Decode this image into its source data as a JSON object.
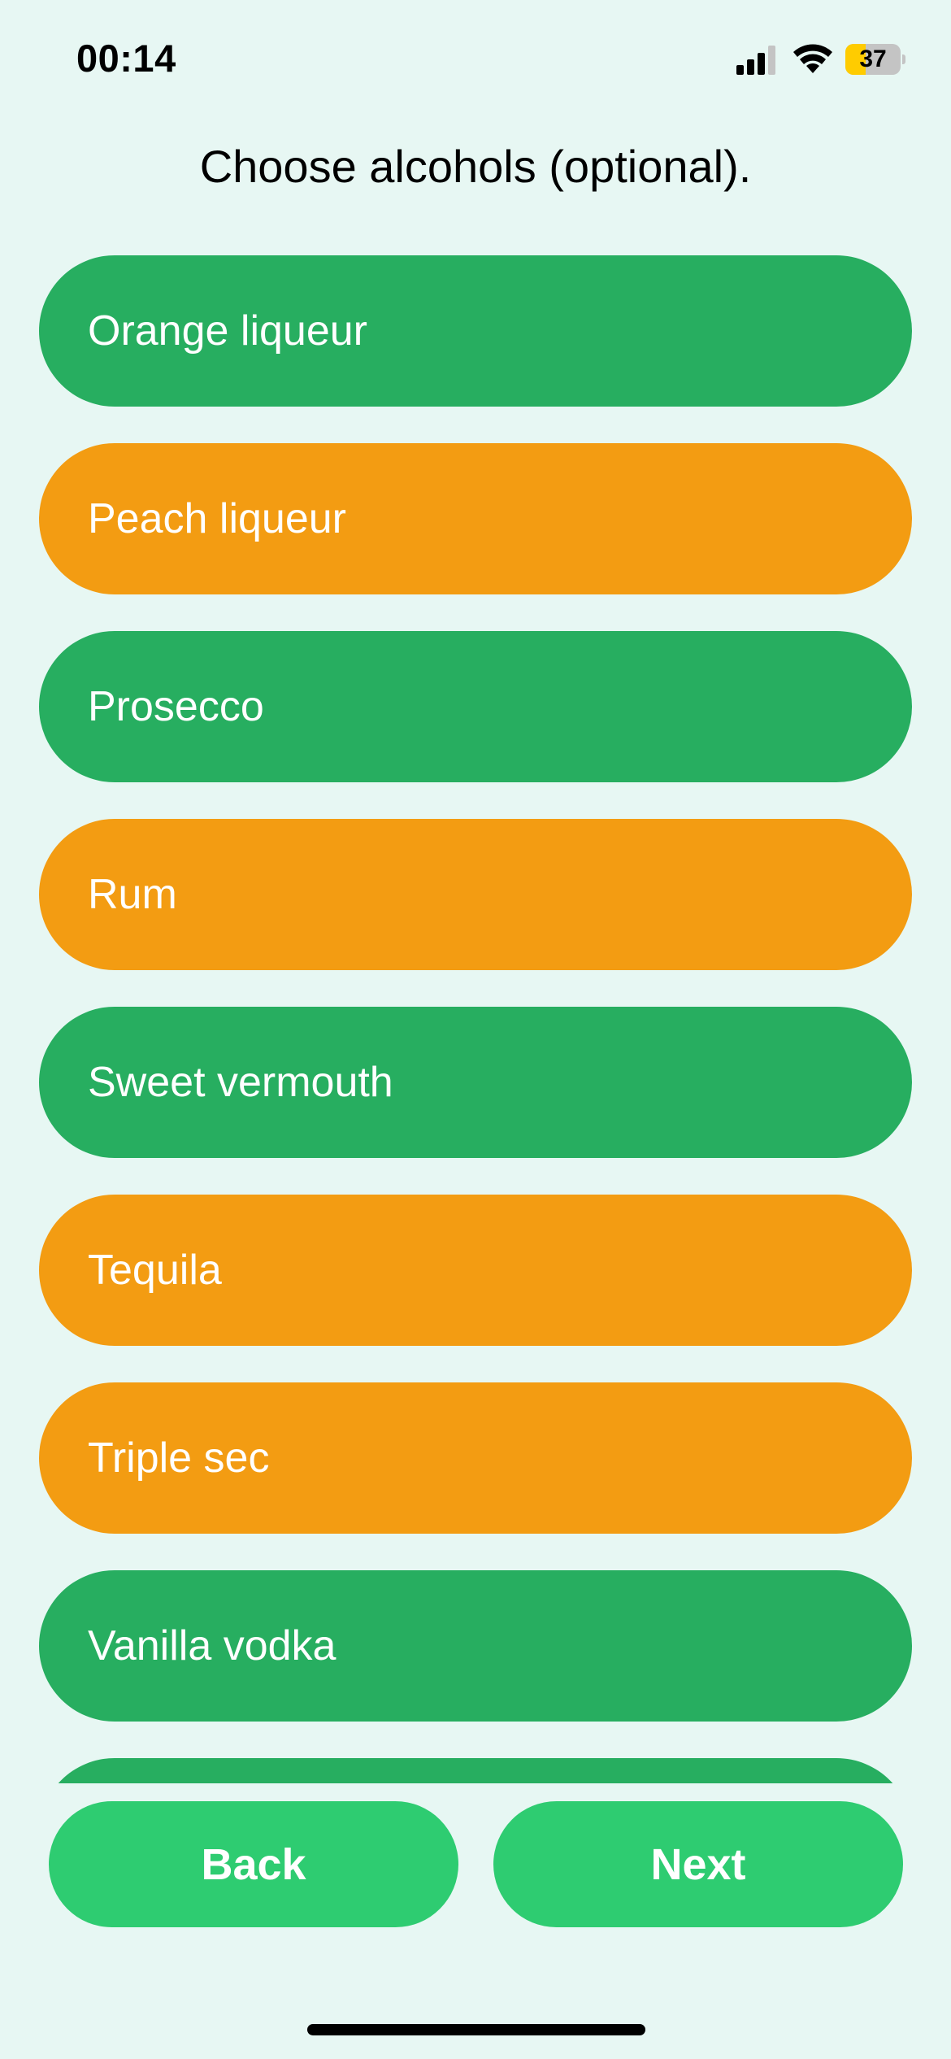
{
  "status_bar": {
    "time": "00:14",
    "battery_level": "37",
    "battery_fraction": 0.37,
    "battery_color": "#ffcc00",
    "icons": [
      "signal-icon",
      "wifi-icon",
      "battery-icon"
    ]
  },
  "title": "Choose alcohols (optional).",
  "colors": {
    "background": "#e7f7f3",
    "option_green": "#27ae60",
    "option_orange": "#f39c12",
    "nav_button": "#2ecc71"
  },
  "options": [
    {
      "label": "Orange liqueur",
      "color": "green"
    },
    {
      "label": "Peach liqueur",
      "color": "orange"
    },
    {
      "label": "Prosecco",
      "color": "green"
    },
    {
      "label": "Rum",
      "color": "orange"
    },
    {
      "label": "Sweet vermouth",
      "color": "green"
    },
    {
      "label": "Tequila",
      "color": "orange"
    },
    {
      "label": "Triple sec",
      "color": "orange"
    },
    {
      "label": "Vanilla vodka",
      "color": "green"
    },
    {
      "label": "",
      "color": "green"
    }
  ],
  "buttons": {
    "back": "Back",
    "next": "Next"
  }
}
